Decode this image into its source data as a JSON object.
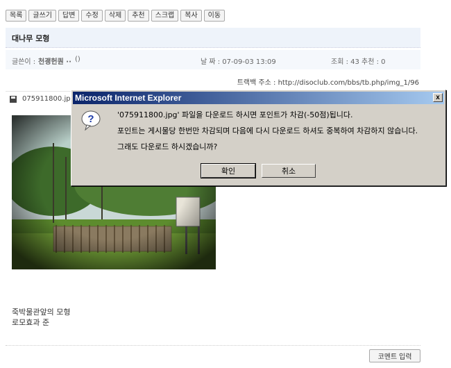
{
  "toolbar": {
    "buttons": [
      "목록",
      "글쓰기",
      "답변",
      "수정",
      "삭제",
      "추천",
      "스크랩",
      "복사",
      "이동"
    ]
  },
  "post": {
    "title": "대나무 모형",
    "author_label": "글쓴이 :",
    "author_name": "천괭헌퀀 ··",
    "author_extra": "()",
    "date_label": "날 짜 : 07-09-03 13:09",
    "stats": "조회 : 43 추천 : 0",
    "trackback": "트랙백 주소 : http://disoclub.com/bbs/tb.php/img_1/96",
    "file": "075911800.jpg (0b",
    "caption_line1": "죽박물관앞의 모형",
    "caption_line2": "로모효과 준"
  },
  "comment_button": "코멘트 입력",
  "dialog": {
    "title": "Microsoft Internet Explorer",
    "close": "x",
    "line1": "'075911800.jpg' 파일을 다운로드 하시면 포인트가 차감(-50점)됩니다.",
    "line2": "포인트는 게시물당 한번만 차감되며 다음에 다시 다운로드 하셔도 중복하여 차감하지 않습니다.",
    "line3": "그래도 다운로드 하시겠습니까?",
    "ok": "확인",
    "cancel": "취소"
  },
  "colors": {
    "dialog_bg": "#d4d0c8",
    "titlebar": "#0a246a",
    "header_bg": "#eef3fa"
  }
}
